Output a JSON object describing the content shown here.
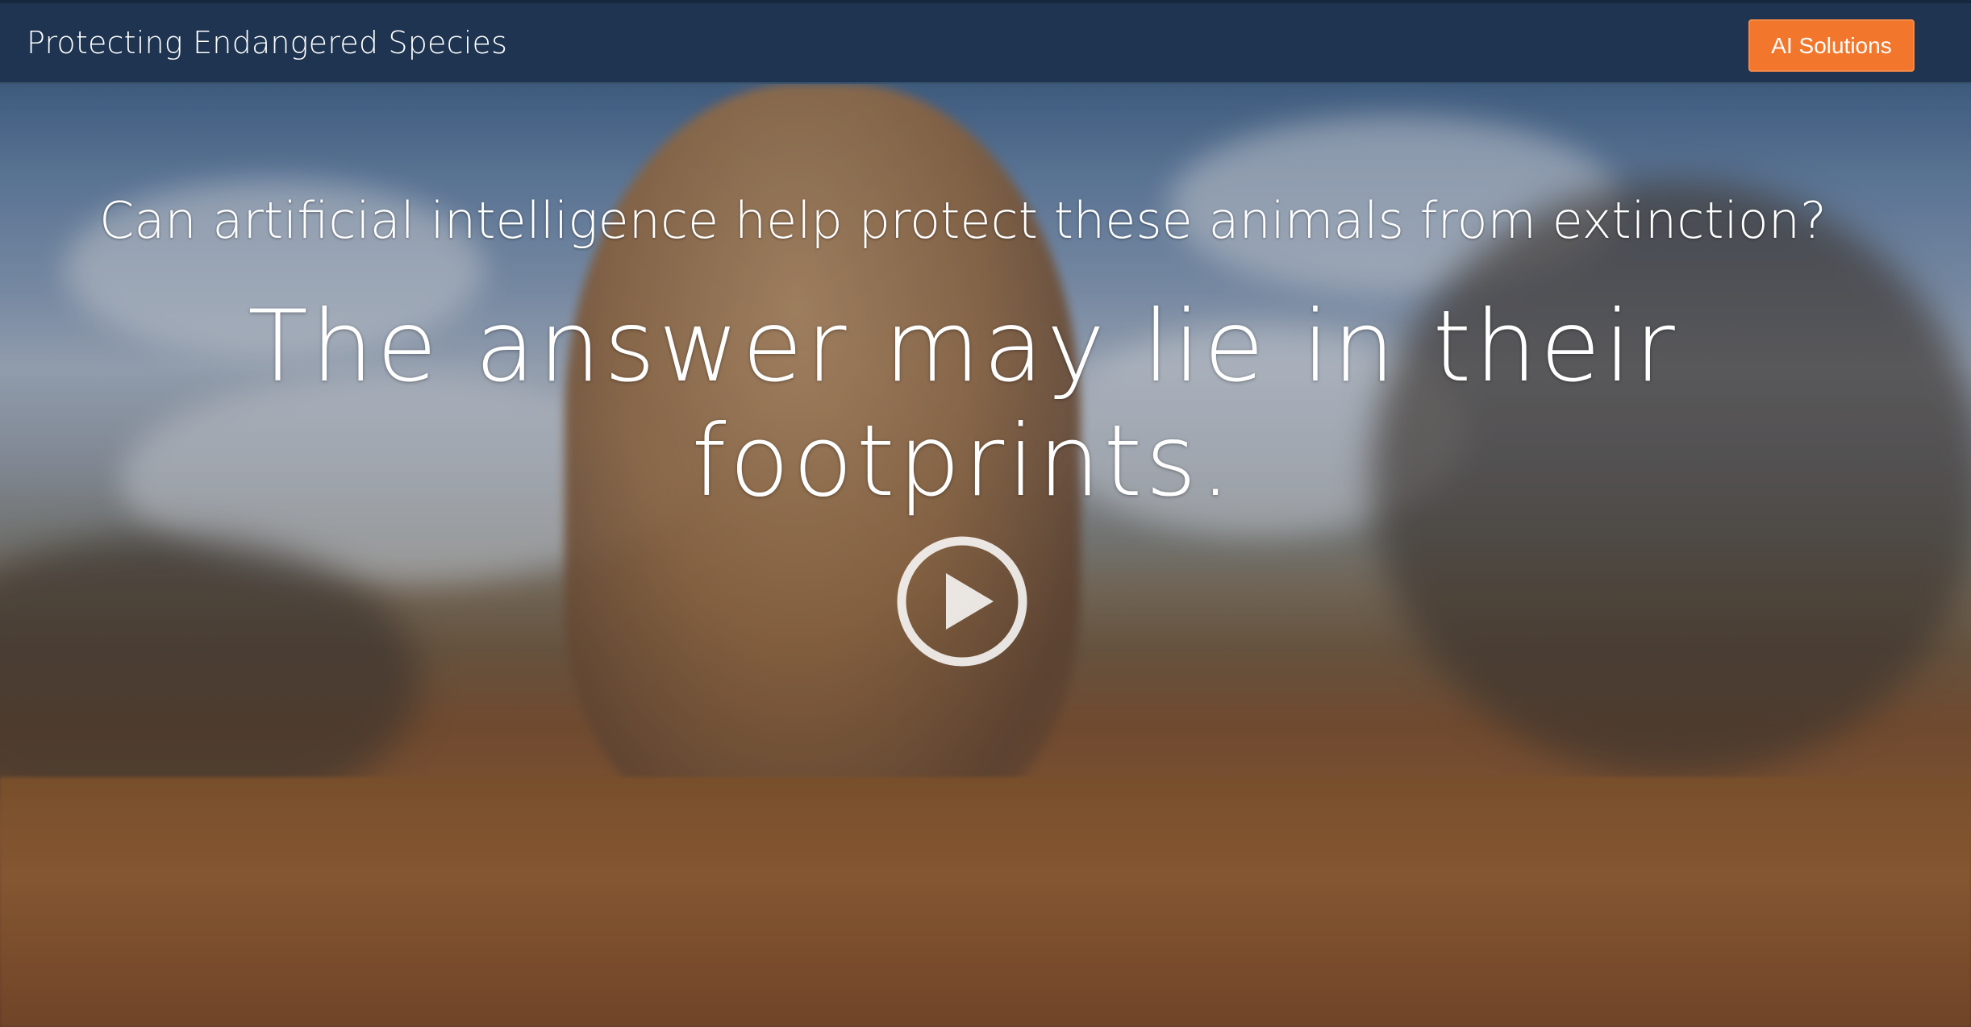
{
  "header": {
    "title": "Protecting Endangered Species",
    "cta_label": "AI Solutions"
  },
  "hero": {
    "question": "Can artificial intelligence help protect these animals from extinction?",
    "answer": "The answer may lie in their footprints.",
    "play_icon": "play-icon"
  },
  "colors": {
    "header_bg": "#1e3450",
    "accent": "#f2772c",
    "text": "#ffffff"
  }
}
